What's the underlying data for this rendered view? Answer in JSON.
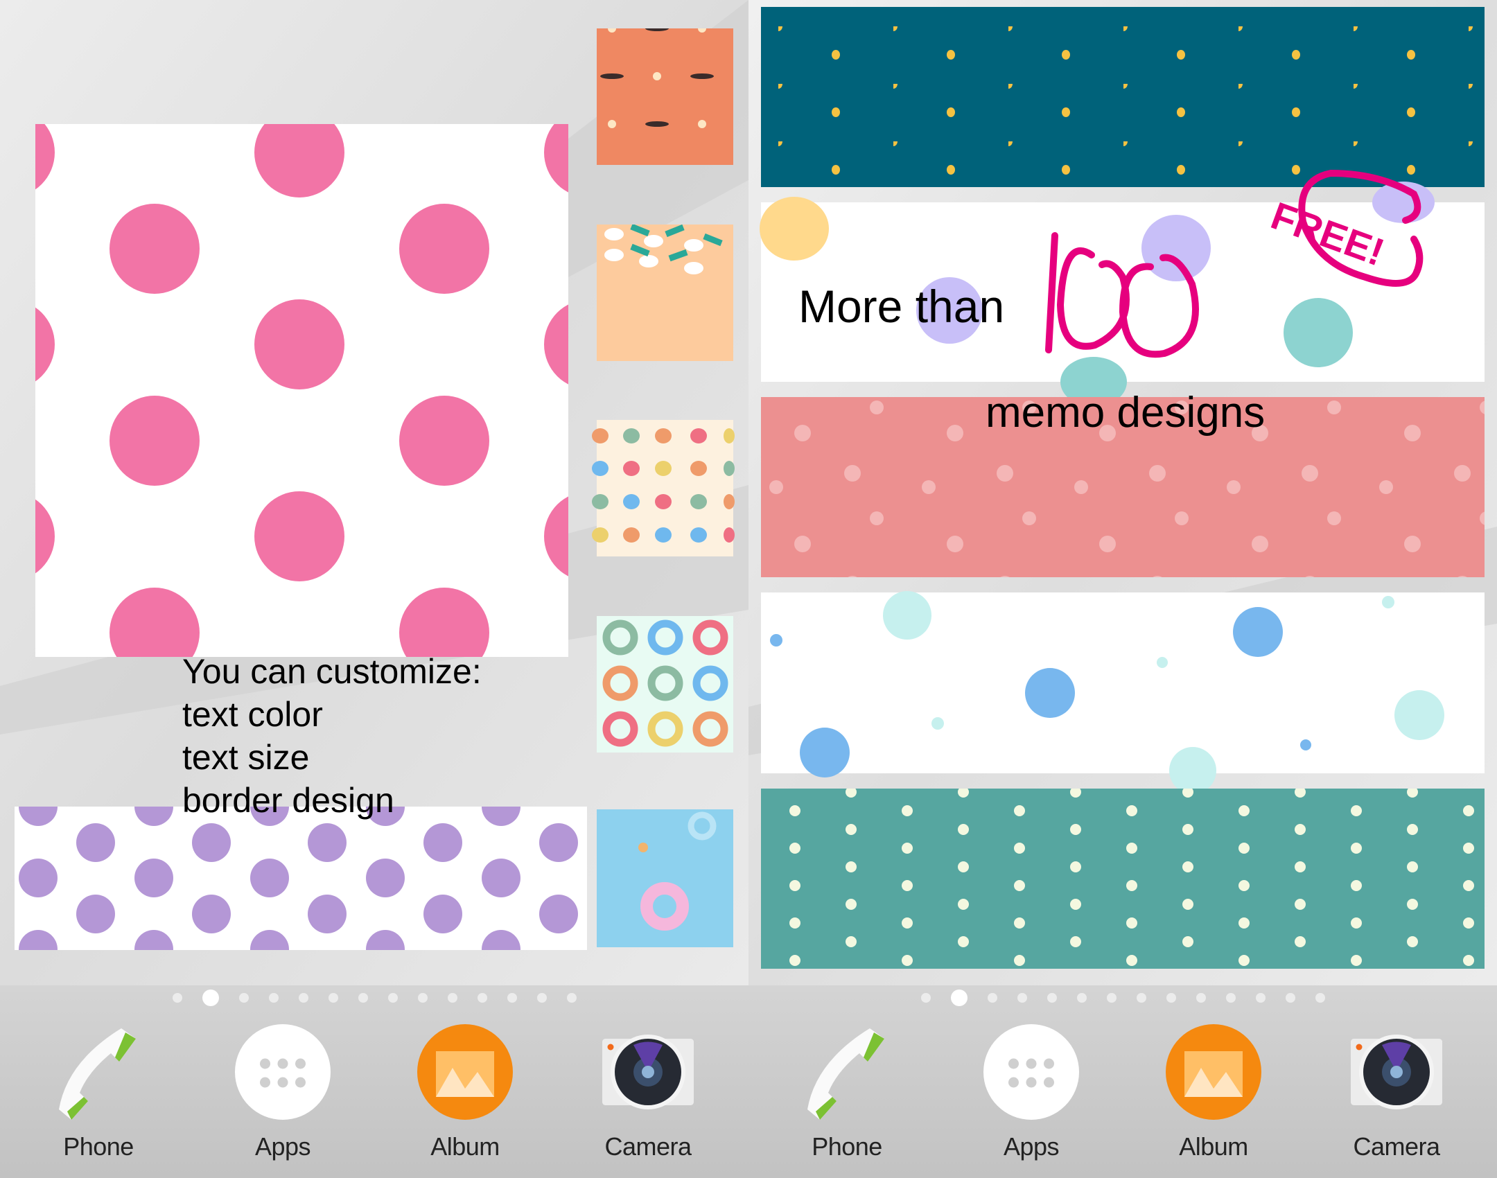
{
  "left_screen": {
    "customize_lines": [
      "You can customize:",
      "text color",
      "text size",
      "border design"
    ]
  },
  "right_screen": {
    "headline_prefix": "More than",
    "headline_number": "100",
    "headline_suffix": "memo designs",
    "badge": "FREE!"
  },
  "page_indicator": {
    "count": 14,
    "active_index": 1
  },
  "dock": {
    "apps": [
      {
        "label": "Phone",
        "icon": "phone-icon"
      },
      {
        "label": "Apps",
        "icon": "apps-grid-icon"
      },
      {
        "label": "Album",
        "icon": "album-icon"
      },
      {
        "label": "Camera",
        "icon": "camera-icon"
      }
    ]
  },
  "colors": {
    "pink_dot": "#f274a6",
    "handwriting": "#e6007e",
    "teal_strip": "#00627a",
    "salmon_strip": "#ec9090",
    "green_strip": "#56a6a0",
    "album_orange": "#f5890f"
  }
}
